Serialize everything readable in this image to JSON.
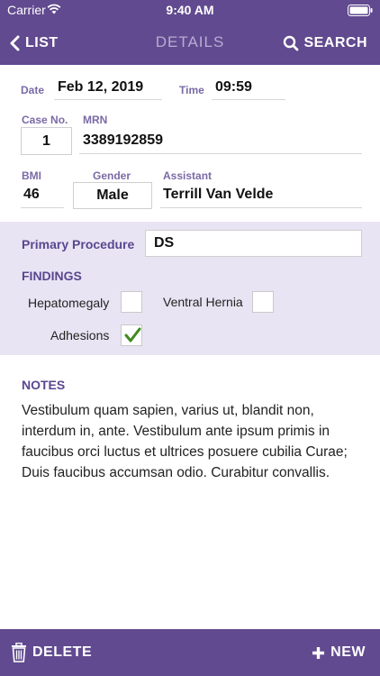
{
  "status_bar": {
    "carrier": "Carrier",
    "time": "9:40 AM"
  },
  "nav": {
    "back_label": "LIST",
    "title": "DETAILS",
    "search_label": "SEARCH"
  },
  "form": {
    "date_label": "Date",
    "date_value": "Feb 12, 2019",
    "time_label": "Time",
    "time_value": "09:59",
    "case_label": "Case No.",
    "case_value": "1",
    "mrn_label": "MRN",
    "mrn_value": "3389192859",
    "bmi_label": "BMI",
    "bmi_value": "46",
    "gender_label": "Gender",
    "gender_value": "Male",
    "assistant_label": "Assistant",
    "assistant_value": "Terrill Van Velde"
  },
  "procedure": {
    "label": "Primary Procedure",
    "value": "DS"
  },
  "findings": {
    "title": "FINDINGS",
    "items": [
      {
        "label": "Hepatomegaly",
        "checked": false
      },
      {
        "label": "Ventral Hernia",
        "checked": false
      },
      {
        "label": "Adhesions",
        "checked": true
      }
    ]
  },
  "notes": {
    "label": "NOTES",
    "text": "Vestibulum quam sapien, varius ut, blandit non, interdum in, ante. Vestibulum ante ipsum primis in faucibus orci luctus et ultrices posuere cubilia Curae; Duis faucibus accumsan odio. Curabitur convallis."
  },
  "toolbar": {
    "delete_label": "DELETE",
    "new_label": "NEW"
  },
  "colors": {
    "brand_purple": "#614a8f",
    "band_lavender": "#e9e4f3",
    "label_purple": "#7a6aa6",
    "check_green": "#3f8a1f"
  },
  "icons": {
    "wifi": "wifi-icon",
    "battery": "battery-icon",
    "back": "chevron-left-icon",
    "search": "search-icon",
    "delete": "trash-icon",
    "new": "plus-icon",
    "check": "checkmark-icon"
  }
}
